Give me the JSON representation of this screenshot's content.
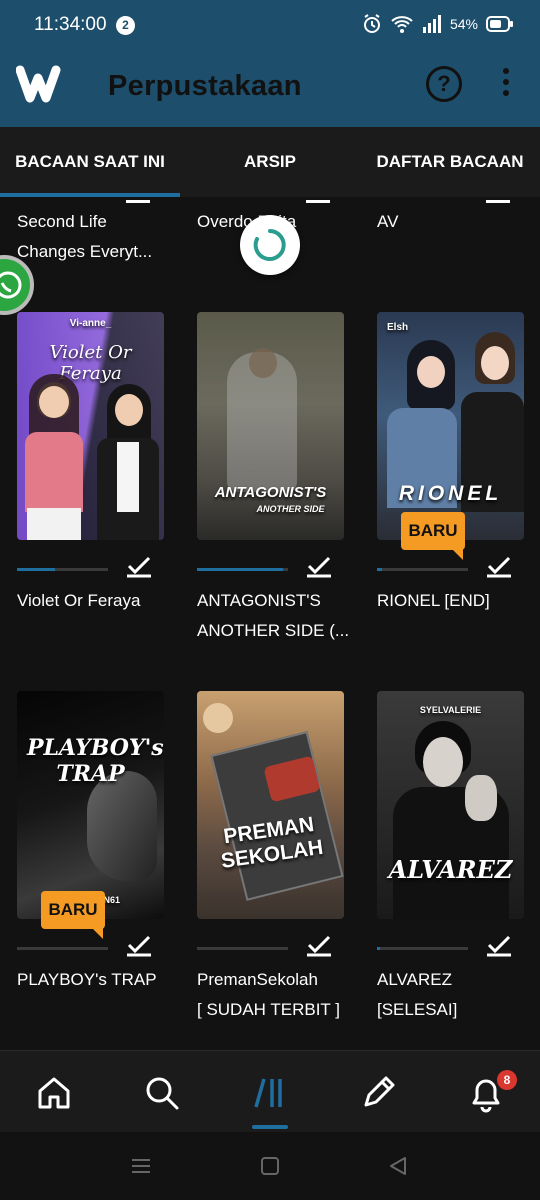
{
  "status_bar": {
    "time": "11:34:00",
    "notification_count": "2",
    "battery_percent": "54%"
  },
  "app_bar": {
    "title": "Perpustakaan",
    "logo_icon": "wattpad-logo",
    "help_icon": "question-icon",
    "more_icon": "more-vertical-icon"
  },
  "tabs": [
    {
      "label": "BACAAN SAAT INI",
      "active": true
    },
    {
      "label": "ARSIP",
      "active": false
    },
    {
      "label": "DAFTAR BACAAN",
      "active": false
    }
  ],
  "partial_row": [
    {
      "line1": "Second Life",
      "line2": "Changes Everyt..."
    },
    {
      "line1": "Overdo    Bhita",
      "line2": ""
    },
    {
      "line1": "AV",
      "line2": ""
    }
  ],
  "books": [
    {
      "cover_text": "Violet Or Feraya",
      "cover_top": "Vi-anne_",
      "line1": "Violet Or Feraya",
      "line2": "",
      "progress": 0.42,
      "read": true,
      "new": false,
      "new_label": ""
    },
    {
      "cover_text": "ANTAGONIST'S",
      "cover_sub": "ANOTHER SIDE",
      "line1": "ANTAGONIST'S",
      "line2": "ANOTHER SIDE (...",
      "progress": 0.95,
      "read": true,
      "new": false,
      "new_label": ""
    },
    {
      "cover_text": "RIONEL",
      "cover_top": "Elsh",
      "line1": "RIONEL [END]",
      "line2": "",
      "progress": 0.05,
      "read": true,
      "new": true,
      "new_label": "BARU"
    },
    {
      "cover_text": "PLAYBOY's TRAP",
      "cover_sub": "DN61",
      "line1": "PLAYBOY's TRAP",
      "line2": "",
      "progress": 0.0,
      "read": true,
      "new": true,
      "new_label": "BARU"
    },
    {
      "cover_text": "PREMAN SEKOLAH",
      "line1": "PremanSekolah",
      "line2": "[ SUDAH TERBIT ]",
      "progress": 0.0,
      "read": true,
      "new": false,
      "new_label": ""
    },
    {
      "cover_text": "ALVAREZ",
      "cover_top": "SYELVALERIE",
      "line1": "ALVAREZ",
      "line2": "[SELESAI]",
      "progress": 0.03,
      "read": true,
      "new": false,
      "new_label": ""
    }
  ],
  "bottom_nav": {
    "items": [
      "home-icon",
      "search-icon",
      "library-icon",
      "write-icon",
      "bell-icon"
    ],
    "notification_count": "8"
  },
  "colors": {
    "brand": "#1d4e6b",
    "accent": "#1e6fa0",
    "badge_new": "#f59a23",
    "notif": "#d9372f"
  }
}
